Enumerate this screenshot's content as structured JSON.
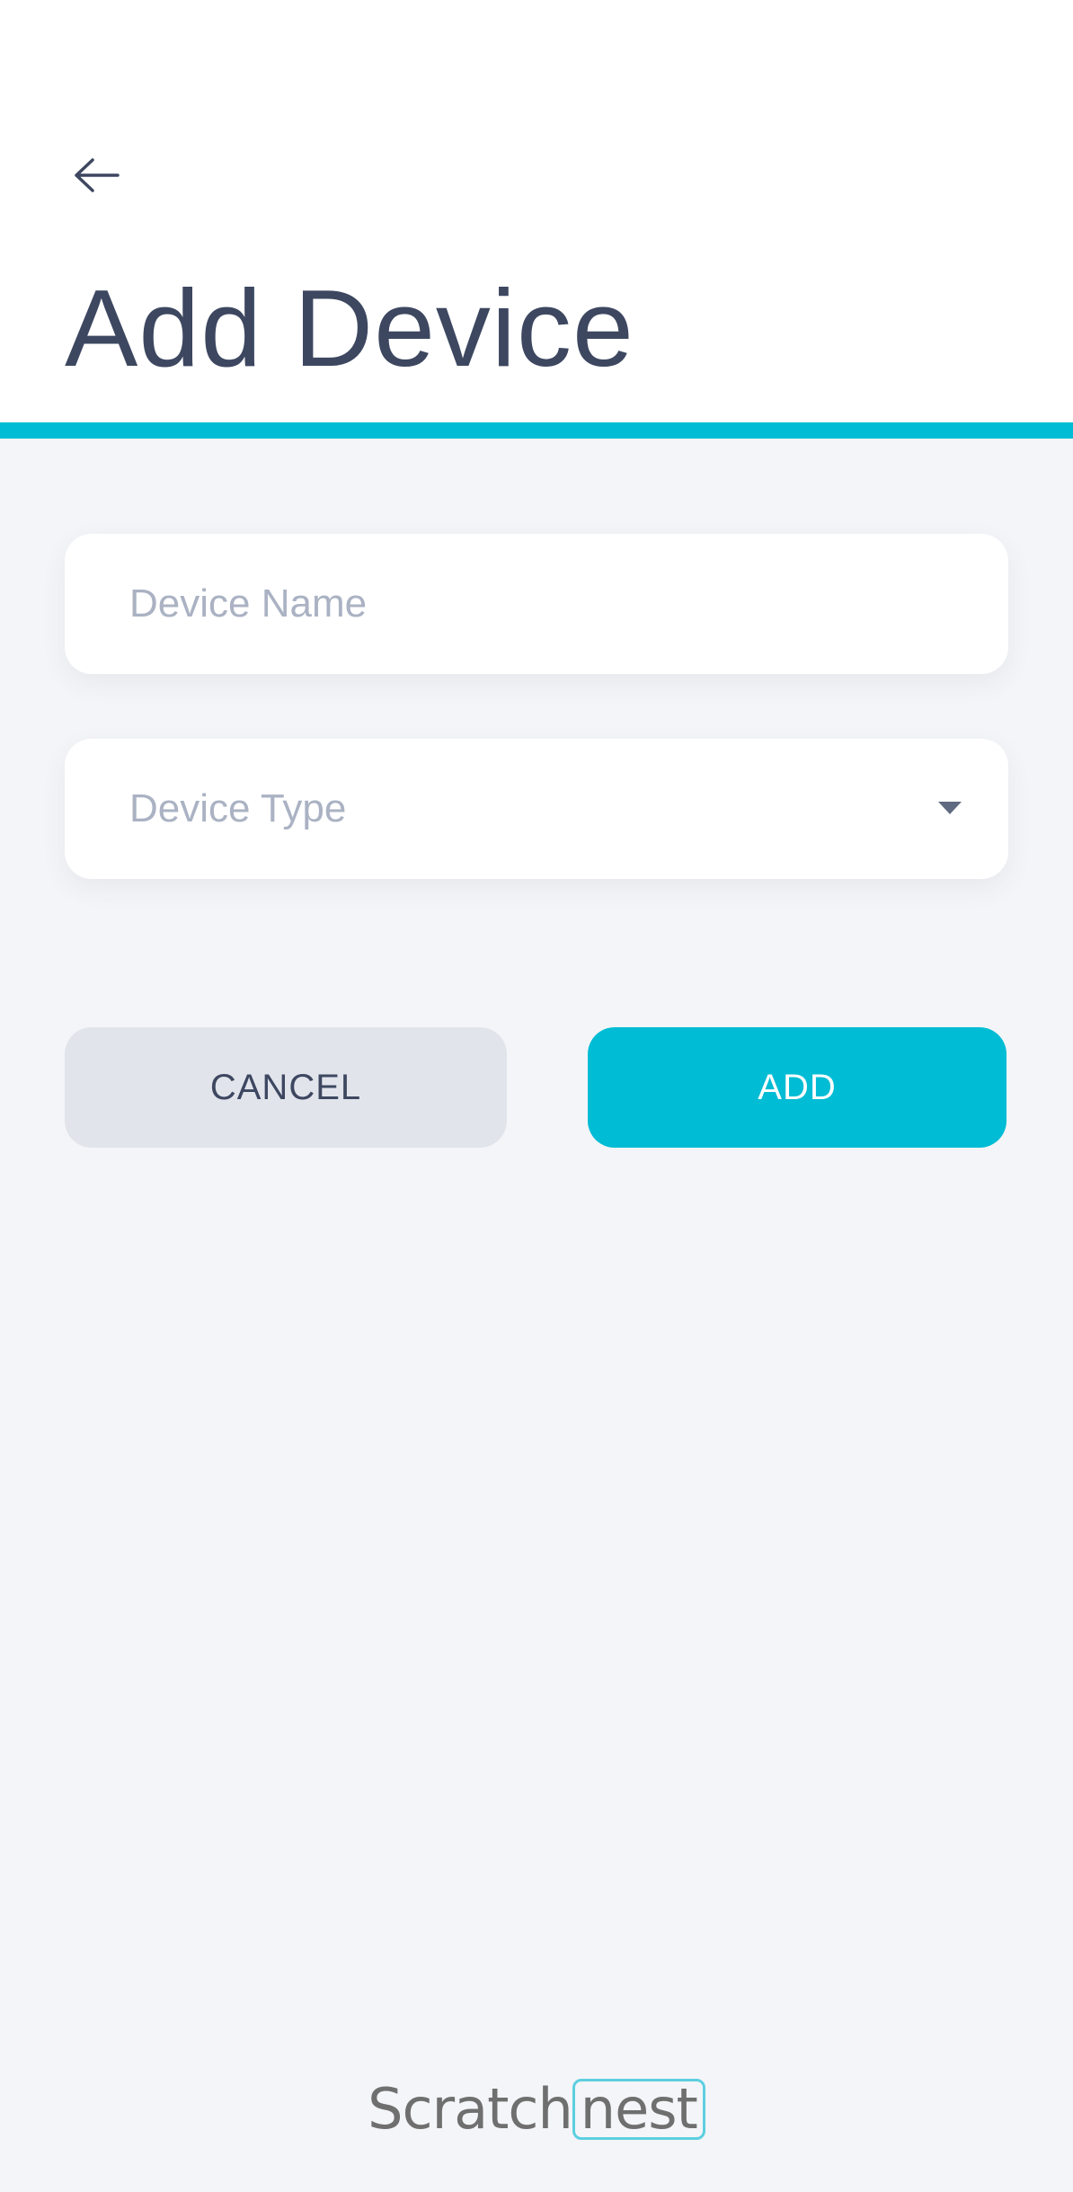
{
  "header": {
    "title": "Add Device",
    "back_icon": "arrow-left-icon",
    "accent_color": "#00bcd4"
  },
  "form": {
    "device_name": {
      "placeholder": "Device Name",
      "value": ""
    },
    "device_type": {
      "placeholder": "Device Type",
      "icon": "caret-down-icon"
    }
  },
  "actions": {
    "cancel_label": "CANCEL",
    "add_label": "ADD"
  },
  "footer": {
    "logo_part1": "Scratch",
    "logo_part2": "nest"
  }
}
